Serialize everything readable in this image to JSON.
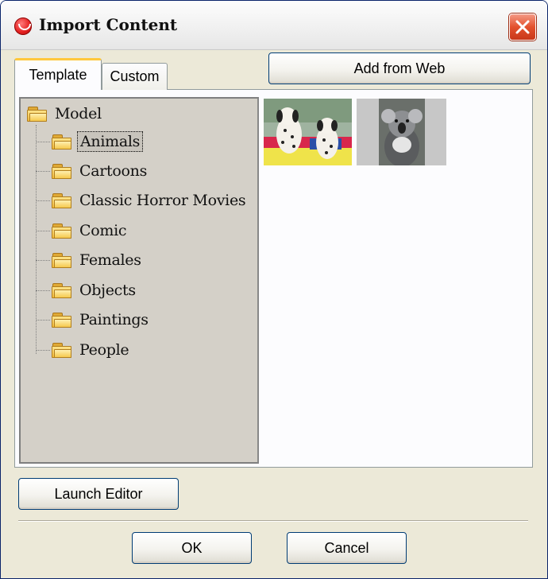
{
  "window": {
    "title": "Import Content",
    "close_icon": "close-icon"
  },
  "tabs": [
    {
      "label": "Template",
      "active": true
    },
    {
      "label": "Custom",
      "active": false
    }
  ],
  "toolbar": {
    "add_from_web_label": "Add from Web"
  },
  "tree": {
    "root": {
      "label": "Model",
      "icon": "folder-icon"
    },
    "items": [
      {
        "label": "Animals",
        "icon": "folder-icon",
        "selected": true
      },
      {
        "label": "Cartoons",
        "icon": "folder-icon",
        "selected": false
      },
      {
        "label": "Classic Horror Movies",
        "icon": "folder-icon",
        "selected": false
      },
      {
        "label": "Comic",
        "icon": "folder-icon",
        "selected": false
      },
      {
        "label": "Females",
        "icon": "folder-icon",
        "selected": false
      },
      {
        "label": "Objects",
        "icon": "folder-icon",
        "selected": false
      },
      {
        "label": "Paintings",
        "icon": "folder-icon",
        "selected": false
      },
      {
        "label": "People",
        "icon": "folder-icon",
        "selected": false
      }
    ]
  },
  "thumbnails": [
    {
      "subject": "dalmatians-image"
    },
    {
      "subject": "koala-image"
    }
  ],
  "footer": {
    "launch_editor_label": "Launch Editor",
    "ok_label": "OK",
    "cancel_label": "Cancel"
  },
  "colors": {
    "window_bg": "#ece9d8",
    "tree_bg": "#d4d0c8",
    "close_button": "#e3512d",
    "active_tab_accent": "#ffc83c"
  }
}
